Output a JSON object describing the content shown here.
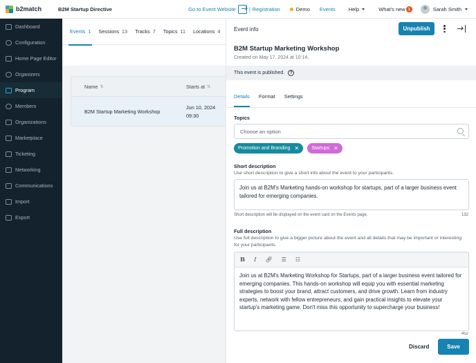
{
  "app": {
    "logo_text": "b2match",
    "event_name": "B2M Startup Directive"
  },
  "topbar": {
    "event_website": "Go to Event Website",
    "registration": "Registration",
    "separator": "|",
    "demo": "Demo",
    "events": "Events",
    "help": "Help",
    "whats_new": "What's new",
    "whats_new_count": "1",
    "user_name": "Sarah Smith"
  },
  "sidebar": {
    "items": [
      {
        "label": "Dashboard",
        "icon": "dashboard-icon"
      },
      {
        "label": "Configuration",
        "icon": "gear-icon"
      },
      {
        "label": "Home Page Editor",
        "icon": "edit-icon"
      },
      {
        "label": "Organizers",
        "icon": "organizers-icon"
      },
      {
        "label": "Program",
        "icon": "calendar-icon",
        "active": true
      },
      {
        "label": "Members",
        "icon": "members-icon"
      },
      {
        "label": "Organizations",
        "icon": "building-icon"
      },
      {
        "label": "Marketplace",
        "icon": "marketplace-icon"
      },
      {
        "label": "Ticketing",
        "icon": "ticket-icon"
      },
      {
        "label": "Networking",
        "icon": "handshake-icon"
      },
      {
        "label": "Communications",
        "icon": "mail-icon"
      },
      {
        "label": "Import",
        "icon": "import-icon"
      },
      {
        "label": "Export",
        "icon": "export-icon"
      }
    ]
  },
  "program_tabs": [
    {
      "label": "Events",
      "count": "1"
    },
    {
      "label": "Sessions",
      "count": "13"
    },
    {
      "label": "Tracks",
      "count": "7"
    },
    {
      "label": "Topics",
      "count": "11"
    },
    {
      "label": "Locations",
      "count": "4"
    }
  ],
  "table": {
    "headers": {
      "name": "Name",
      "starts_at": "Starts at"
    },
    "row": {
      "name": "B2M Startup Marketing Workshop",
      "date": "Jun 10, 2024",
      "time": "09:30"
    }
  },
  "drawer": {
    "header_title": "Event info",
    "unpublish": "Unpublish",
    "event_title": "B2M Startup Marketing Workshop",
    "created": "Created on May 17, 2024 at 10:14.",
    "published_notice": "This event is published.",
    "tabs": [
      "Details",
      "Format",
      "Settings"
    ],
    "topics": {
      "label": "Topics",
      "placeholder": "Choose an option",
      "chips": [
        "Promotion and Branding",
        "Startups"
      ]
    },
    "short_description": {
      "label": "Short description",
      "hint": "Use short description to give a short info about the event to your participants.",
      "value": "Join us at B2M's Marketing hands-on workshop for startups, part of a larger business event tailored for emerging companies.",
      "footer_hint": "Short description will be displayed on the event card on the Events page.",
      "char_count": "132"
    },
    "full_description": {
      "label": "Full description",
      "hint": "Use full description to give a bigger picture about the event and all details that may be important or interesting for your participants.",
      "value": "Join us at B2M's Marketing Workshop for Startups, part of a larger business event tailored for emerging companies. This hands-on workshop will equip you with essential marketing strategies to boost your brand, attract customers, and drive growth. Learn from industry experts, network with fellow entrepreneurs, and gain practical insights to elevate your startup's marketing game. Don't miss this opportunity to supercharge your business!",
      "char_count": "452"
    },
    "discard": "Discard",
    "save": "Save"
  }
}
